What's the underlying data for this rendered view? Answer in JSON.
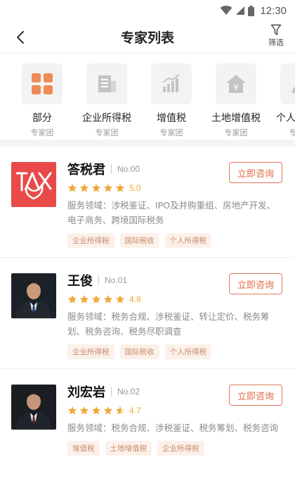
{
  "status_bar": {
    "time": "12:30"
  },
  "nav": {
    "title": "专家列表",
    "filter_label": "筛选"
  },
  "categories": [
    {
      "name": "部分",
      "sub": "专家团",
      "icon": "grid-icon",
      "active": true
    },
    {
      "name": "企业所得税",
      "sub": "专家团",
      "icon": "building-icon"
    },
    {
      "name": "增值税",
      "sub": "专家团",
      "icon": "bar-chart-icon"
    },
    {
      "name": "土地增值税",
      "sub": "专家团",
      "icon": "house-yen-icon"
    },
    {
      "name": "个人所得税",
      "sub": "专家团",
      "icon": "person-icon"
    }
  ],
  "experts": [
    {
      "name": "答税君",
      "no": "No.00",
      "score": "5.0",
      "stars": 5,
      "service": "服务领域：涉税鉴证、IPO及并购重组、房地产开发、电子商务、跨境国际税务",
      "tags": [
        "企业所得税",
        "国际税收",
        "个人所得税"
      ],
      "button": "立即咨询",
      "avatar": "tax-logo"
    },
    {
      "name": "王俊",
      "no": "No.01",
      "score": "4.8",
      "stars": 5,
      "service": "服务领域：税务合规、涉税鉴证、转让定价、税务筹划、税务咨询、税务尽职调查",
      "tags": [
        "企业所得税",
        "国际税收",
        "个人所得税"
      ],
      "button": "立即咨询",
      "avatar": "photo"
    },
    {
      "name": "刘宏岩",
      "no": "No.02",
      "score": "4.7",
      "stars": 5,
      "service": "服务领域：税务合规、涉税鉴证、税务筹划、税务咨询",
      "tags": [
        "增值税",
        "土地增值税",
        "企业所得税"
      ],
      "button": "立即咨询",
      "avatar": "photo"
    }
  ],
  "colors": {
    "accent": "#e06a40",
    "star": "#f1a83a",
    "tag_bg": "#fcf1ea",
    "tag_text": "#c98a6a",
    "logo_bg": "#e84a4a",
    "cat_active": "#f08a55"
  }
}
